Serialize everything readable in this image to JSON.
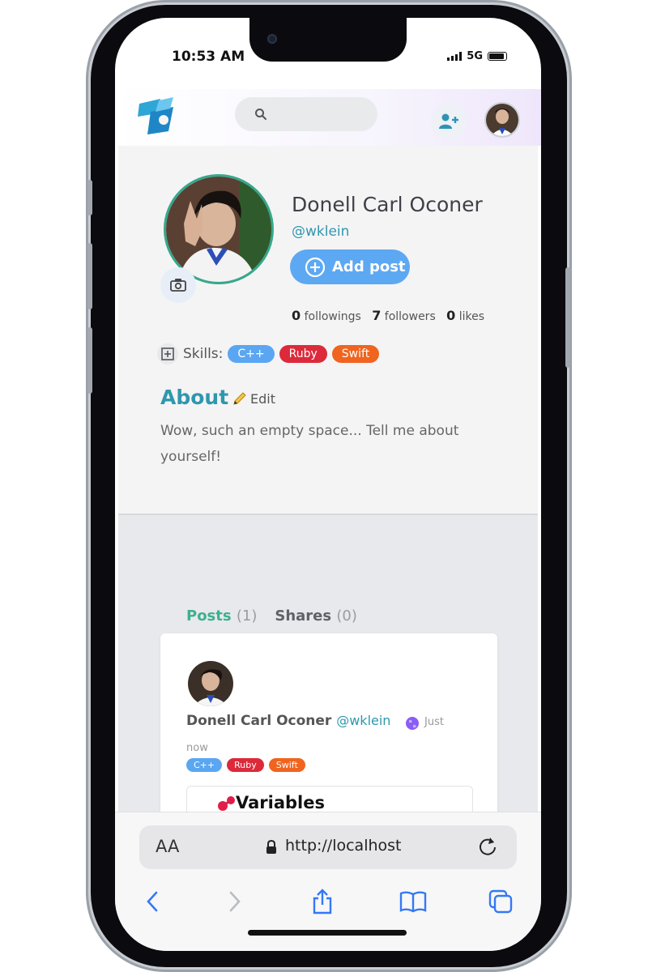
{
  "status_bar": {
    "time": "10:53 AM",
    "network": "5G"
  },
  "app_bar": {
    "logo_icon": "app-logo-icon",
    "search_icon": "search-icon",
    "add_friend_icon": "add-friend-icon",
    "avatar_icon": "user-avatar"
  },
  "profile": {
    "name": "Donell Carl Oconer",
    "handle": "@wklein",
    "add_post_label": "Add post",
    "stats": {
      "followings_count": "0",
      "followings_label": "followings",
      "followers_count": "7",
      "followers_label": "followers",
      "likes_count": "0",
      "likes_label": "likes"
    },
    "skills_label": "Skills:",
    "skills": [
      {
        "label": "C++",
        "color": "#5aa6f2"
      },
      {
        "label": "Ruby",
        "color": "#dc2a3b"
      },
      {
        "label": "Swift",
        "color": "#f0641f"
      }
    ],
    "about_title": "About",
    "about_edit": "Edit",
    "about_text": "Wow, such an empty space... Tell me about yourself!"
  },
  "tabs": {
    "posts_label": "Posts",
    "posts_count": "(1)",
    "shares_label": "Shares",
    "shares_count": "(0)"
  },
  "post": {
    "author": "Donell Carl Oconer",
    "handle": "@wklein",
    "time_line1": "Just",
    "time_line2": "now",
    "tags": [
      "C++",
      "Ruby",
      "Swift"
    ],
    "embed_title": "Variables"
  },
  "browser": {
    "aa_label": "AA",
    "url": "http://localhost"
  },
  "colors": {
    "accent_teal": "#2f97ae",
    "accent_green": "#35a88c",
    "button_blue": "#5da8f2"
  }
}
